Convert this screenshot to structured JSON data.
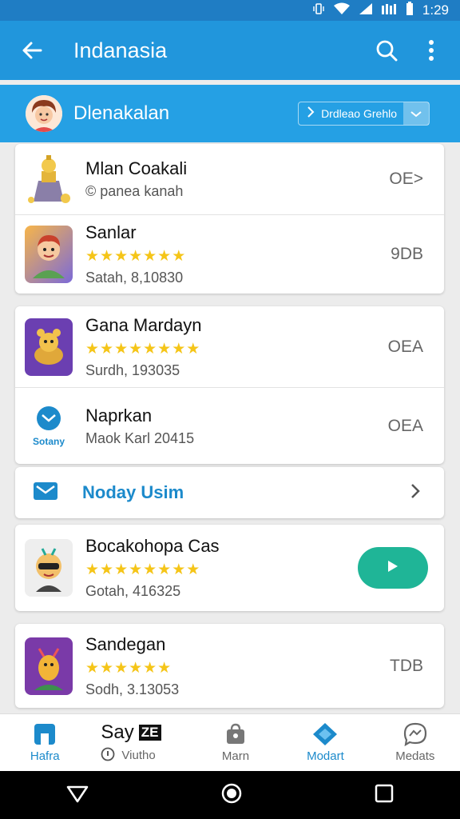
{
  "status": {
    "time": "1:29"
  },
  "app_bar": {
    "title": "Indanasia",
    "back_icon": "arrow-left-icon",
    "search_icon": "search-icon",
    "more_icon": "more-vertical-icon"
  },
  "sub_bar": {
    "title": "Dlenakalan",
    "action_label": "Drdleao Grehlo"
  },
  "card1": [
    {
      "title": "Mlan Coakali",
      "subtitle": "© panea kanah",
      "meta": "OE>"
    },
    {
      "title": "Sanlar",
      "stars": "★★★★★★★",
      "subtitle": "Satah, 8,10830",
      "meta": "9DB"
    }
  ],
  "card2": [
    {
      "title": "Gana Mardayn",
      "stars": "★★★★★★★★",
      "subtitle": "Surdh, 193035",
      "meta": "OEA"
    },
    {
      "title": "Naprkan",
      "thumb_label": "Sotany",
      "subtitle": "Maok Karl 20415",
      "meta": "OEA"
    }
  ],
  "link_row": {
    "label": "Noday Usim"
  },
  "card4": {
    "title": "Bocakohopa Cas",
    "stars": "★★★★★★★★",
    "subtitle": "Gotah, 416325"
  },
  "card5": {
    "title": "Sandegan",
    "stars": "★★★★★★",
    "subtitle": "Sodh, 3.13053",
    "meta": "TDB"
  },
  "bottom_nav": {
    "items": [
      {
        "label": "Hafra",
        "icon": "home-icon"
      },
      {
        "label": "Say",
        "badge": "ZE",
        "sub_label": "Viutho"
      },
      {
        "label": "Marn",
        "icon": "bag-icon"
      },
      {
        "label": "Modart",
        "icon": "diamond-icon"
      },
      {
        "label": "Medats",
        "icon": "messenger-icon"
      }
    ]
  },
  "colors": {
    "primary": "#2196dc",
    "status": "#1f7dc4",
    "accent": "#1c8acb",
    "play": "#1fb597",
    "star": "#f5c518"
  }
}
